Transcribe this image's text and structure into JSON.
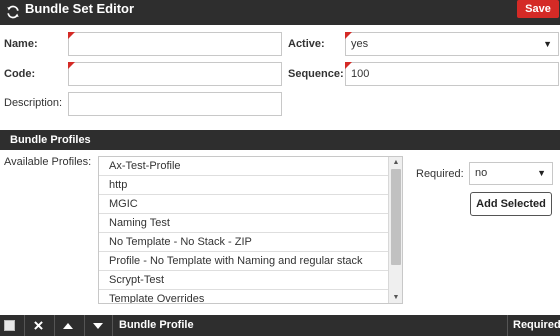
{
  "header": {
    "title": "Bundle Set Editor",
    "refresh_icon": "refresh-icon",
    "save_label": "Save",
    "accent_color": "#d42a26"
  },
  "form": {
    "name_label": "Name:",
    "name_value": "",
    "code_label": "Code:",
    "code_value": "",
    "description_label": "Description:",
    "description_value": "",
    "active_label": "Active:",
    "active_value": "yes",
    "sequence_label": "Sequence:",
    "sequence_value": "100"
  },
  "bundle_profiles": {
    "section_title": "Bundle Profiles",
    "available_label": "Available Profiles:",
    "profiles": [
      "Ax-Test-Profile",
      "http",
      "MGIC",
      "Naming Test",
      "No Template - No Stack - ZIP",
      "Profile - No Template with Naming and regular stack",
      "Scrypt-Test",
      "Template Overrides"
    ],
    "required_label": "Required:",
    "required_value": "no",
    "add_selected_label": "Add Selected"
  },
  "table": {
    "columns": {
      "bundle_profile": "Bundle Profile",
      "required": "Required"
    }
  }
}
